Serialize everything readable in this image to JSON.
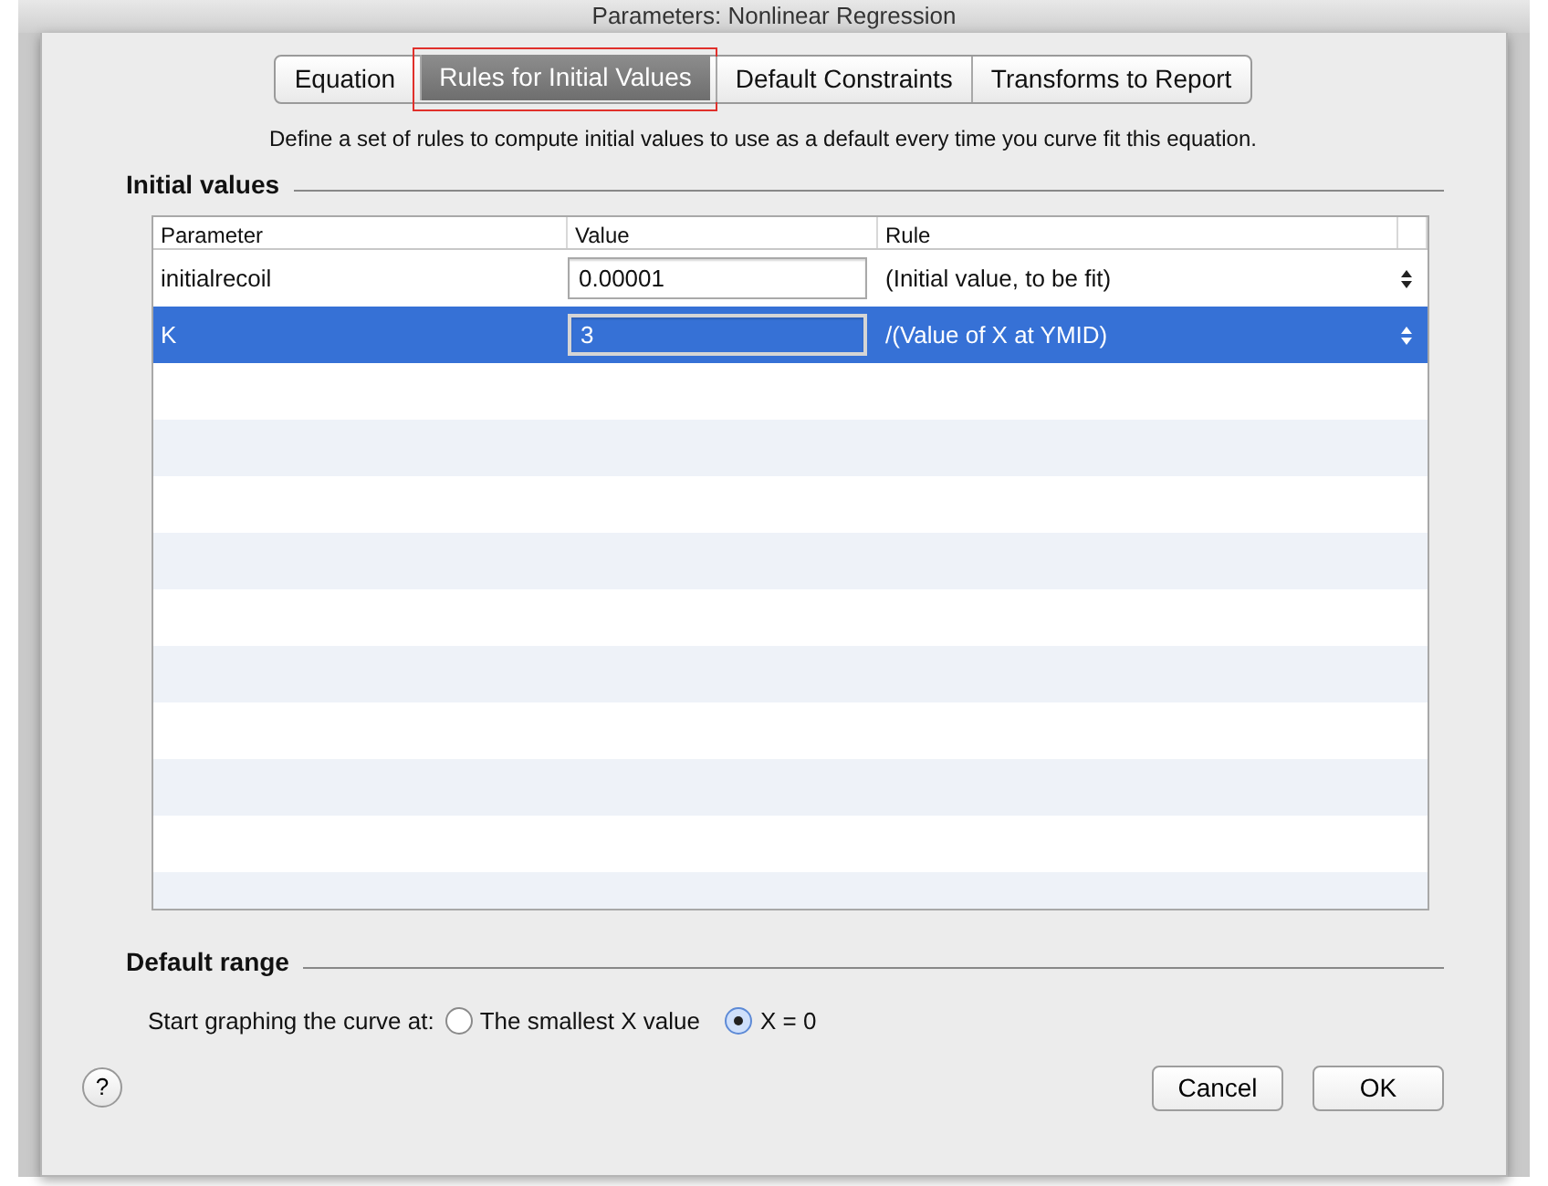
{
  "window": {
    "title": "Parameters: Nonlinear Regression"
  },
  "tabs": [
    {
      "label": "Equation",
      "selected": false
    },
    {
      "label": "Rules for Initial Values",
      "selected": true
    },
    {
      "label": "Default Constraints",
      "selected": false
    },
    {
      "label": "Transforms to Report",
      "selected": false
    }
  ],
  "description": "Define a set of rules to compute initial values to use as a default every time you curve fit this equation.",
  "initial_values": {
    "heading": "Initial values",
    "table": {
      "columns": [
        "Parameter",
        "Value",
        "Rule"
      ],
      "rows": [
        {
          "parameter": "initialrecoil",
          "value": "0.00001",
          "rule": "(Initial value, to be fit)",
          "selected": false
        },
        {
          "parameter": "K",
          "value": "3",
          "rule": "/(Value of X at YMID)",
          "selected": true
        }
      ]
    }
  },
  "default_range": {
    "heading": "Default range",
    "label": "Start graphing the curve at:",
    "options": [
      {
        "label": "The smallest X value",
        "selected": false
      },
      {
        "label": "X = 0",
        "selected": true
      }
    ]
  },
  "help_button": "?",
  "buttons": [
    "Cancel",
    "OK"
  ]
}
